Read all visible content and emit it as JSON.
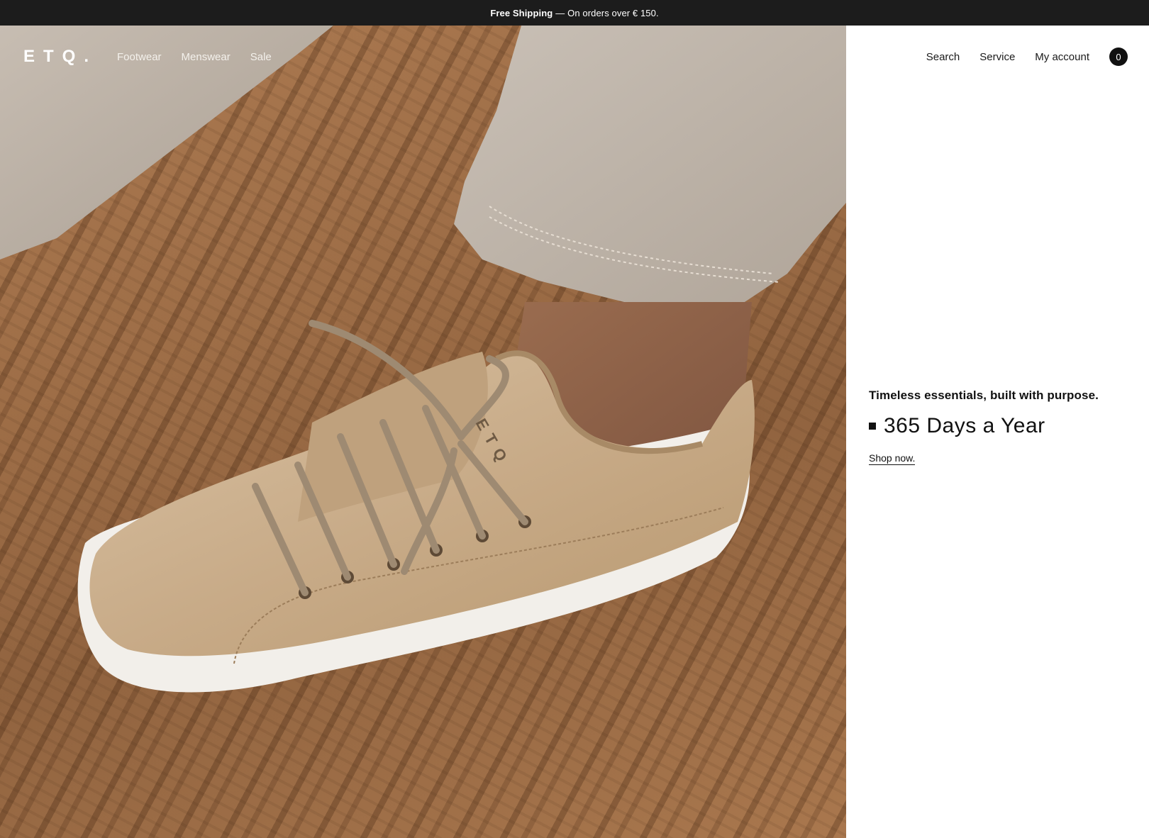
{
  "announcement": {
    "bold": "Free Shipping",
    "rest": "— On orders over € 150."
  },
  "header": {
    "logo": "ETQ.",
    "nav_left": [
      "Footwear",
      "Menswear",
      "Sale"
    ],
    "nav_right": [
      "Search",
      "Service",
      "My account"
    ],
    "cart_count": "0"
  },
  "hero": {
    "image_subject": "beige leather sneaker on sand with trouser cuff",
    "shoe_branding": "ETQ"
  },
  "promo": {
    "tagline": "Timeless essentials, built with purpose.",
    "headline": "365 Days a Year",
    "cta": "Shop now."
  },
  "colors": {
    "announcement_bg": "#1c1c1c",
    "text_dark": "#111111",
    "sand": "#9a6a44",
    "shoe": "#c8ab88",
    "trouser": "#bdb2a6"
  }
}
